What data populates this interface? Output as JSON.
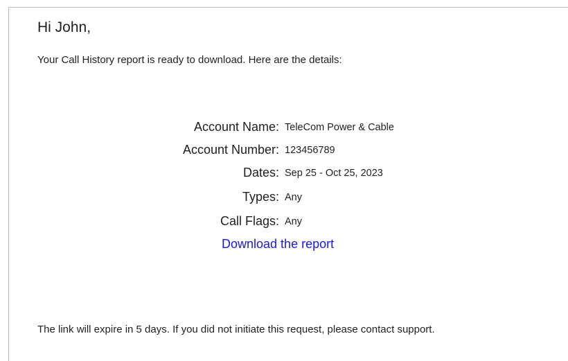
{
  "email": {
    "greeting": "Hi John,",
    "intro": "Your Call History report is ready to download. Here are the details:",
    "details": [
      {
        "label": "Account Name:",
        "value": "TeleCom Power & Cable"
      },
      {
        "label": "Account Number:",
        "value": "123456789"
      },
      {
        "label": "Dates:",
        "value": "Sep 25 - Oct 25, 2023"
      },
      {
        "label": "Types:",
        "value": "Any"
      },
      {
        "label": "Call Flags:",
        "value": "Any"
      }
    ],
    "download_link": "Download the report",
    "footer": "The link will expire in 5 days. If you did not initiate this request, please contact support."
  },
  "colors": {
    "link": "#1a17e6",
    "text": "#1f1f1f",
    "border": "#bdbdbd"
  }
}
